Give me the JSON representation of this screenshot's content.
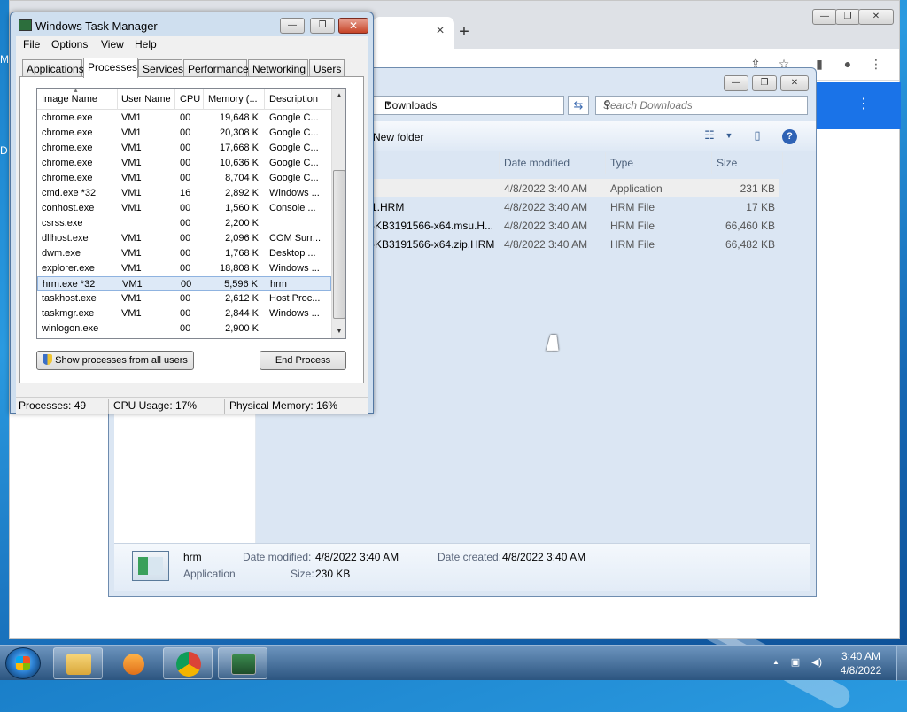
{
  "desktop": {
    "icon_letters": [
      "M",
      "D"
    ]
  },
  "chrome": {
    "new_tab": "+",
    "tab_close": "×",
    "controls": {
      "minimize": "—",
      "restore": "❐",
      "close": "✕"
    }
  },
  "explorer": {
    "controls": {
      "minimize": "—",
      "restore": "❐",
      "close": "✕"
    },
    "address": "Downloads",
    "search_placeholder": "Search Downloads",
    "new_folder": "New folder",
    "columns": [
      "Date modified",
      "Type",
      "Size"
    ],
    "rows": [
      {
        "name": "",
        "date": "4/8/2022 3:40 AM",
        "type": "Application",
        "size": "231 KB",
        "selected": true
      },
      {
        "name": "1.HRM",
        "date": "4/8/2022 3:40 AM",
        "type": "HRM File",
        "size": "17 KB"
      },
      {
        "name": "-KB3191566-x64.msu.H...",
        "date": "4/8/2022 3:40 AM",
        "type": "HRM File",
        "size": "66,460 KB"
      },
      {
        "name": "-KB3191566-x64.zip.HRM",
        "date": "4/8/2022 3:40 AM",
        "type": "HRM File",
        "size": "66,482 KB"
      }
    ],
    "details": {
      "name": "hrm",
      "type": "Application",
      "date_modified_label": "Date modified:",
      "date_modified": "4/8/2022 3:40 AM",
      "date_created_label": "Date created:",
      "date_created": "4/8/2022 3:40 AM",
      "size_label": "Size:",
      "size": "230 KB"
    }
  },
  "task_manager": {
    "title": "Windows Task Manager",
    "controls": {
      "minimize": "—",
      "restore": "❐",
      "close": "✕"
    },
    "menu": [
      "File",
      "Options",
      "View",
      "Help"
    ],
    "tabs": [
      "Applications",
      "Processes",
      "Services",
      "Performance",
      "Networking",
      "Users"
    ],
    "active_tab": "Processes",
    "columns": [
      "Image Name",
      "User Name",
      "CPU",
      "Memory (...",
      "Description"
    ],
    "processes": [
      {
        "image": "chrome.exe",
        "user": "VM1",
        "cpu": "00",
        "memory": "19,648 K",
        "desc": "Google C..."
      },
      {
        "image": "chrome.exe",
        "user": "VM1",
        "cpu": "00",
        "memory": "20,308 K",
        "desc": "Google C..."
      },
      {
        "image": "chrome.exe",
        "user": "VM1",
        "cpu": "00",
        "memory": "17,668 K",
        "desc": "Google C..."
      },
      {
        "image": "chrome.exe",
        "user": "VM1",
        "cpu": "00",
        "memory": "10,636 K",
        "desc": "Google C..."
      },
      {
        "image": "chrome.exe",
        "user": "VM1",
        "cpu": "00",
        "memory": "8,704 K",
        "desc": "Google C..."
      },
      {
        "image": "cmd.exe *32",
        "user": "VM1",
        "cpu": "16",
        "memory": "2,892 K",
        "desc": "Windows ..."
      },
      {
        "image": "conhost.exe",
        "user": "VM1",
        "cpu": "00",
        "memory": "1,560 K",
        "desc": "Console ..."
      },
      {
        "image": "csrss.exe",
        "user": "",
        "cpu": "00",
        "memory": "2,200 K",
        "desc": ""
      },
      {
        "image": "dllhost.exe",
        "user": "VM1",
        "cpu": "00",
        "memory": "2,096 K",
        "desc": "COM Surr..."
      },
      {
        "image": "dwm.exe",
        "user": "VM1",
        "cpu": "00",
        "memory": "1,768 K",
        "desc": "Desktop ..."
      },
      {
        "image": "explorer.exe",
        "user": "VM1",
        "cpu": "00",
        "memory": "18,808 K",
        "desc": "Windows ..."
      },
      {
        "image": "hrm.exe *32",
        "user": "VM1",
        "cpu": "00",
        "memory": "5,596 K",
        "desc": "hrm",
        "selected": true
      },
      {
        "image": "taskhost.exe",
        "user": "VM1",
        "cpu": "00",
        "memory": "2,612 K",
        "desc": "Host Proc..."
      },
      {
        "image": "taskmgr.exe",
        "user": "VM1",
        "cpu": "00",
        "memory": "2,844 K",
        "desc": "Windows ..."
      },
      {
        "image": "winlogon.exe",
        "user": "",
        "cpu": "00",
        "memory": "2,900 K",
        "desc": ""
      }
    ],
    "show_all_button": "Show processes from all users",
    "end_process_button": "End Process",
    "status": {
      "processes": "Processes: 49",
      "cpu": "CPU Usage: 17%",
      "memory": "Physical Memory: 16%"
    }
  },
  "taskbar": {
    "clock_time": "3:40 AM",
    "clock_date": "4/8/2022",
    "tray_arrow": "▲"
  }
}
